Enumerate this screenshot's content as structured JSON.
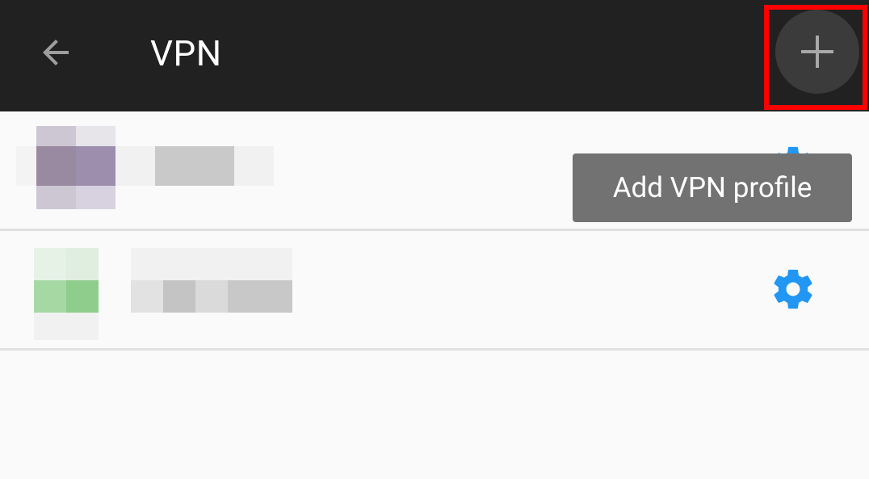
{
  "appbar": {
    "title": "VPN",
    "back_icon": "arrow-back-icon",
    "add_icon": "plus-icon"
  },
  "tooltip": {
    "text": "Add VPN profile"
  },
  "vpn_profiles": [
    {
      "name_redacted": true,
      "settings_icon": "gear-icon"
    },
    {
      "name_redacted": true,
      "settings_icon": "gear-icon"
    }
  ],
  "colors": {
    "appbar_bg": "#212121",
    "accent": "#2196f3",
    "highlight": "#ff0000",
    "tooltip_bg": "#727272"
  }
}
